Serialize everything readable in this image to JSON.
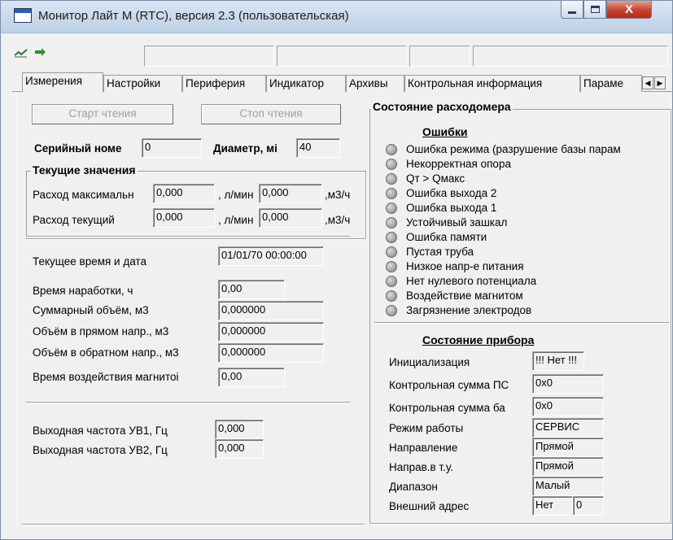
{
  "window": {
    "title": "Монитор Лайт М (RTC), версия 2.3 (пользовательская)",
    "close_glyph": "X"
  },
  "toolbar": {
    "icons": [
      "connect-icon",
      "refresh-icon"
    ],
    "status_fields": [
      "",
      "",
      "",
      ""
    ]
  },
  "tabs": [
    "Измерения",
    "Настройки",
    "Периферия",
    "Индикатор",
    "Архивы",
    "Контрольная информация",
    "Параме"
  ],
  "tab_scroll": {
    "left": "◀",
    "right": "▶"
  },
  "measure": {
    "start_label": "Старт чтения",
    "stop_label": "Стоп чтения",
    "serial_label": "Серийный номе",
    "serial_value": "0",
    "diameter_label": "Диаметр, мі",
    "diameter_value": "40",
    "current_title": "Текущие значения",
    "flow_max_label": "Расход максимальн",
    "flow_max_lpm": "0,000",
    "unit_lpm": ", л/мин",
    "flow_max_m3h": "0,000",
    "unit_m3h": ",м3/ч",
    "flow_cur_label": "Расход текущий",
    "flow_cur_lpm": "0,000",
    "flow_cur_m3h": "0,000",
    "datetime_label": "Текущее время и дата",
    "datetime_value": "01/01/70 00:00:00",
    "runtime_label": "Время наработки, ч",
    "runtime_value": "0,00",
    "vol_total_label": "Суммарный объём, м3",
    "vol_total_value": "0,000000",
    "vol_fwd_label": "Объём в прямом напр., м3",
    "vol_fwd_value": "0,000000",
    "vol_rev_label": "Объём в обратном напр., м3",
    "vol_rev_value": "0,000000",
    "magnet_time_label": "Время воздействия магнитоі",
    "magnet_time_value": "0,00",
    "freq1_label": "Выходная частота УВ1, Гц",
    "freq1_value": "0,000",
    "freq2_label": "Выходная частота УВ2, Гц",
    "freq2_value": "0,000"
  },
  "state": {
    "title": "Состояние расходомера",
    "errors_title": "Ошибки",
    "errors": [
      "Ошибка режима (разрушение базы парам",
      "Некорректная опора",
      "Qт > Qмакс",
      "Ошибка выхода 2",
      "Ошибка выхода 1",
      "Устойчивый зашкал",
      "Ошибка памяти",
      "Пустая труба",
      "Низкое напр-е питания",
      "Нет нулевого потенциала",
      "Воздействие магнитом",
      "Загрязнение электродов"
    ],
    "device_title": "Состояние прибора",
    "init_label": "Инициализация",
    "init_value": "!!! Нет !!!",
    "crc_po_label": "Контрольная сумма ПС",
    "crc_po_value": "0x0",
    "crc_base_label": "Контрольная сумма ба",
    "crc_base_value": "0x0",
    "mode_label": "Режим работы",
    "mode_value": "СЕРВИС",
    "dir_label": "Направление",
    "dir_value": "Прямой",
    "dir_tu_label": "Направ.в т.у.",
    "dir_tu_value": "Прямой",
    "range_label": "Диапазон",
    "range_value": "Малый",
    "ext_addr_label": "Внешний адрес",
    "ext_addr_value": "Нет",
    "ext_addr_num": "0"
  }
}
